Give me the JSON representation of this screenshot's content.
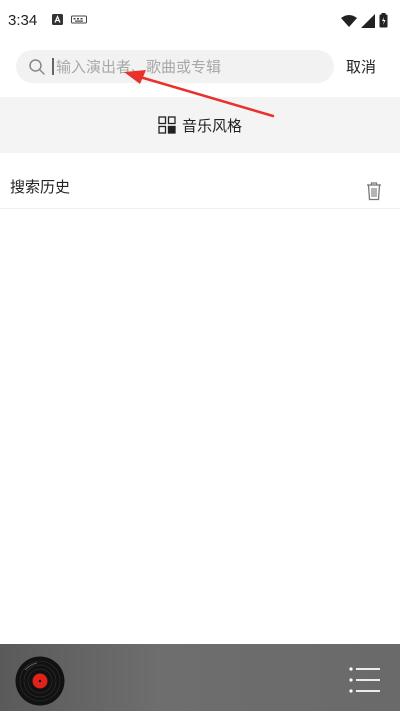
{
  "status_bar": {
    "time": "3:34",
    "left_icons": [
      "a-badge-icon",
      "keyboard-icon"
    ],
    "right_icons": [
      "wifi-icon",
      "signal-icon",
      "battery-icon"
    ]
  },
  "search": {
    "placeholder": "输入演出者、歌曲或专辑",
    "value": "",
    "cancel_label": "取消"
  },
  "music_style": {
    "label": "音乐风格",
    "icon": "grid-squares-icon"
  },
  "history": {
    "title": "搜索历史",
    "items": [],
    "clear_icon": "trash-icon"
  },
  "player": {
    "disc_icon": "vinyl-disc-icon",
    "playlist_icon": "playlist-icon"
  },
  "colors": {
    "annotation_arrow": "#e8322b",
    "player_bar": "#666666",
    "search_box": "#f2f2f2"
  }
}
